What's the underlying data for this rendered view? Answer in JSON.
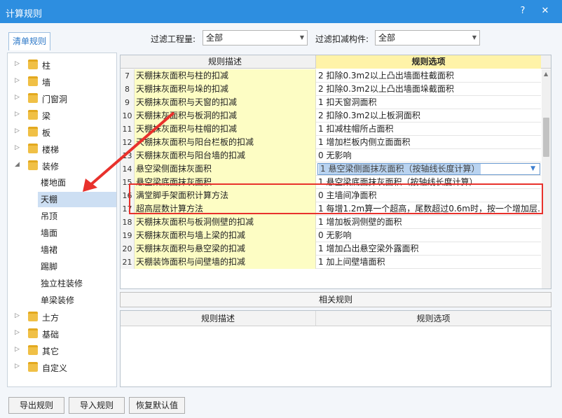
{
  "window": {
    "title": "计算规则",
    "help_glyph": "?",
    "close_glyph": "✕"
  },
  "tab": {
    "label": "清单规则"
  },
  "filters": {
    "project_label": "过滤工程量:",
    "project_value": "全部",
    "deduct_label": "过滤扣减构件:",
    "deduct_value": "全部"
  },
  "tree": {
    "top": [
      {
        "label": "柱"
      },
      {
        "label": "墙"
      },
      {
        "label": "门窗洞"
      },
      {
        "label": "梁"
      },
      {
        "label": "板"
      },
      {
        "label": "楼梯"
      }
    ],
    "expanded": {
      "label": "装修",
      "children": [
        "楼地面",
        "天棚",
        "吊顶",
        "墙面",
        "墙裙",
        "踢脚",
        "独立柱装修",
        "单梁装修"
      ]
    },
    "bottom": [
      {
        "label": "土方"
      },
      {
        "label": "基础"
      },
      {
        "label": "其它"
      },
      {
        "label": "自定义"
      }
    ]
  },
  "grid": {
    "headers": [
      "规则描述",
      "规则选项"
    ],
    "rows": [
      {
        "num": "7",
        "desc": "天棚抹灰面积与柱的扣减",
        "opt": "2 扣除0.3m2以上凸出墙面柱截面积"
      },
      {
        "num": "8",
        "desc": "天棚抹灰面积与垛的扣减",
        "opt": "2 扣除0.3m2以上凸出墙面垛截面积"
      },
      {
        "num": "9",
        "desc": "天棚抹灰面积与天窗的扣减",
        "opt": "1 扣天窗洞面积"
      },
      {
        "num": "10",
        "desc": "天棚抹灰面积与板洞的扣减",
        "opt": "2 扣除0.3m2以上板洞面积"
      },
      {
        "num": "11",
        "desc": "天棚抹灰面积与柱帽的扣减",
        "opt": "1 扣减柱帽所占面积"
      },
      {
        "num": "12",
        "desc": "天棚抹灰面积与阳台栏板的扣减",
        "opt": "1 增加栏板内侧立面面积"
      },
      {
        "num": "13",
        "desc": "天棚抹灰面积与阳台墙的扣减",
        "opt": "0   无影响"
      },
      {
        "num": "14",
        "desc": "悬空梁侧面抹灰面积",
        "opt": "1 悬空梁侧面抹灰面积（按轴线长度计算）"
      },
      {
        "num": "15",
        "desc": "悬空梁底面抹灰面积",
        "opt": "1 悬空梁底面抹灰面积（按轴线长度计算）"
      },
      {
        "num": "16",
        "desc": "满堂脚手架面积计算方法",
        "opt": "0 主墙间净面积"
      },
      {
        "num": "17",
        "desc": "超高层数计算方法",
        "opt": "1 每增1.2m算一个超高，尾数超过0.6m时，按一个增加层…"
      },
      {
        "num": "18",
        "desc": "天棚抹灰面积与板洞侧壁的扣减",
        "opt": "1 增加板洞侧壁的面积"
      },
      {
        "num": "19",
        "desc": "天棚抹灰面积与墙上梁的扣减",
        "opt": "0   无影响"
      },
      {
        "num": "20",
        "desc": "天棚抹灰面积与悬空梁的扣减",
        "opt": "1 增加凸出悬空梁外露面积"
      },
      {
        "num": "21",
        "desc": "天棚装饰面积与间壁墙的扣减",
        "opt": "1 加上间壁墙面积"
      }
    ]
  },
  "related": {
    "title": "相关规则",
    "headers": [
      "规则描述",
      "规则选项"
    ]
  },
  "buttons": {
    "export": "导出规则",
    "import": "导入规则",
    "restore": "恢复默认值"
  },
  "annotation_color": "#e8312c"
}
